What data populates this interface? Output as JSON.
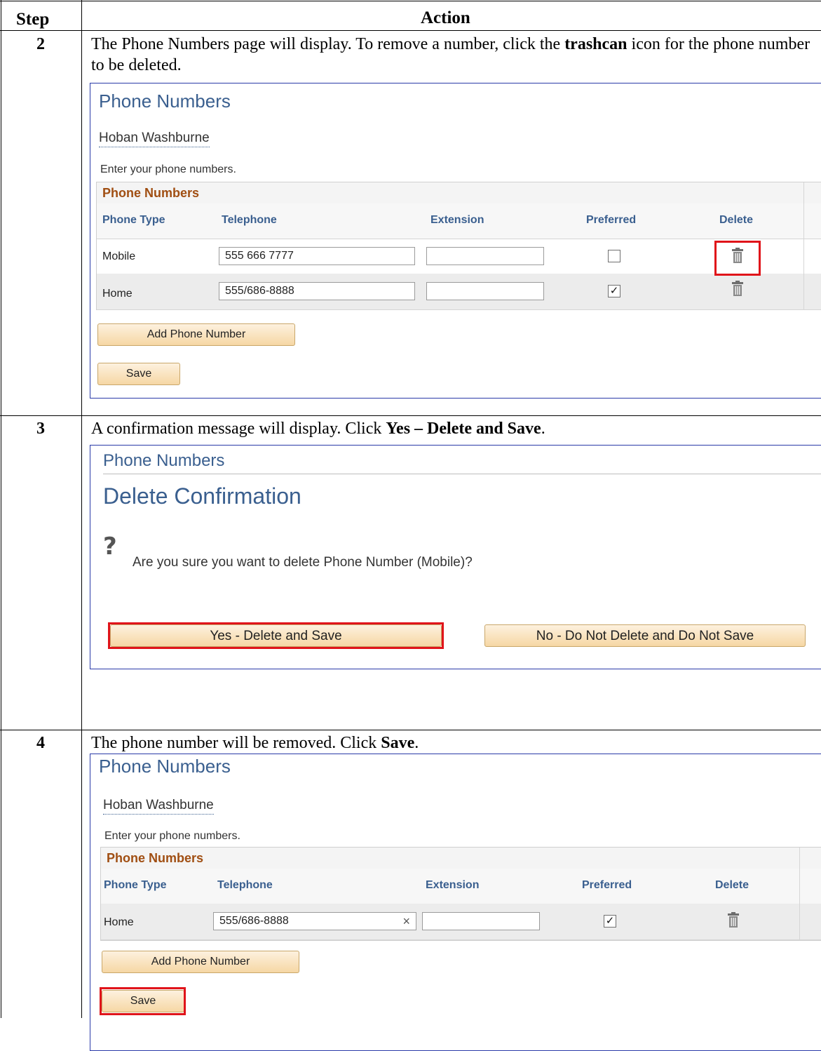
{
  "header": {
    "step_label": "Step",
    "action_label": "Action"
  },
  "steps": [
    {
      "number": "2",
      "text_before": "The Phone Numbers page will display.  To remove a number, click the ",
      "bold": "trashcan",
      "text_after": " icon for the phone number to be deleted."
    },
    {
      "number": "3",
      "text_before": "A confirmation message will display.  Click ",
      "bold": "Yes – Delete and Save",
      "text_after": "."
    },
    {
      "number": "4",
      "text_before": "The phone number will be removed.  Click ",
      "bold": "Save",
      "text_after": "."
    }
  ],
  "panel1": {
    "title": "Phone Numbers",
    "name": "Hoban Washburne",
    "instruction": "Enter your phone numbers.",
    "grid_title": "Phone Numbers",
    "columns": [
      "Phone Type",
      "Telephone",
      "Extension",
      "Preferred",
      "Delete"
    ],
    "rows": [
      {
        "type": "Mobile",
        "telephone": "555 666 7777",
        "extension": "",
        "preferred": ""
      },
      {
        "type": "Home",
        "telephone": "555/686-8888",
        "extension": "",
        "preferred": "✓"
      }
    ],
    "add_button": "Add Phone Number",
    "save_button": "Save"
  },
  "panel2": {
    "title": "Phone Numbers",
    "heading": "Delete Confirmation",
    "question_icon": "?",
    "message": "Are you sure you want to delete Phone Number (Mobile)?",
    "yes_button": "Yes - Delete and Save",
    "no_button": "No - Do Not Delete and Do Not Save"
  },
  "panel3": {
    "title": "Phone Numbers",
    "name": "Hoban Washburne",
    "instruction": "Enter your phone numbers.",
    "grid_title": "Phone Numbers",
    "columns": [
      "Phone Type",
      "Telephone",
      "Extension",
      "Preferred",
      "Delete"
    ],
    "rows": [
      {
        "type": "Home",
        "telephone": "555/686-8888",
        "clear": "×",
        "extension": "",
        "preferred": "✓"
      }
    ],
    "add_button": "Add Phone Number",
    "save_button": "Save"
  },
  "colors": {
    "highlight": "#e0141a",
    "title_blue": "#3a5f8f",
    "grid_orange": "#a04e12"
  }
}
